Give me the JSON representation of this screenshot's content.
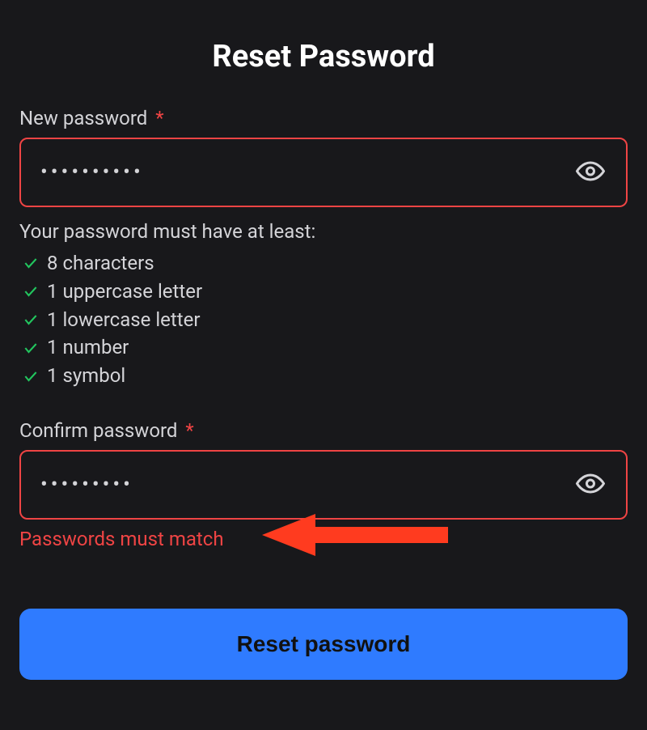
{
  "title": "Reset Password",
  "fields": {
    "new_password": {
      "label": "New password",
      "required_mark": "*",
      "value": "••••••••••"
    },
    "confirm_password": {
      "label": "Confirm password",
      "required_mark": "*",
      "value": "•••••••••"
    }
  },
  "requirements": {
    "title": "Your password must have at least:",
    "items": [
      {
        "label": "8 characters",
        "met": true
      },
      {
        "label": "1 uppercase letter",
        "met": true
      },
      {
        "label": "1 lowercase letter",
        "met": true
      },
      {
        "label": "1 number",
        "met": true
      },
      {
        "label": "1 symbol",
        "met": true
      }
    ]
  },
  "error": "Passwords must match",
  "submit_label": "Reset password",
  "colors": {
    "error": "#ef4444",
    "success": "#22c55e",
    "primary": "#2f7bff",
    "bg": "#18181b"
  }
}
